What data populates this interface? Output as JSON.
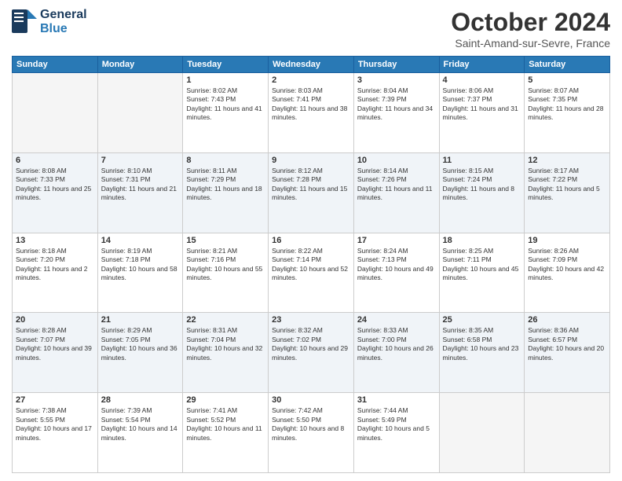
{
  "header": {
    "logo_line1": "General",
    "logo_line2": "Blue",
    "month": "October 2024",
    "location": "Saint-Amand-sur-Sevre, France"
  },
  "days_of_week": [
    "Sunday",
    "Monday",
    "Tuesday",
    "Wednesday",
    "Thursday",
    "Friday",
    "Saturday"
  ],
  "weeks": [
    [
      {
        "day": "",
        "text": ""
      },
      {
        "day": "",
        "text": ""
      },
      {
        "day": "1",
        "text": "Sunrise: 8:02 AM\nSunset: 7:43 PM\nDaylight: 11 hours and 41 minutes."
      },
      {
        "day": "2",
        "text": "Sunrise: 8:03 AM\nSunset: 7:41 PM\nDaylight: 11 hours and 38 minutes."
      },
      {
        "day": "3",
        "text": "Sunrise: 8:04 AM\nSunset: 7:39 PM\nDaylight: 11 hours and 34 minutes."
      },
      {
        "day": "4",
        "text": "Sunrise: 8:06 AM\nSunset: 7:37 PM\nDaylight: 11 hours and 31 minutes."
      },
      {
        "day": "5",
        "text": "Sunrise: 8:07 AM\nSunset: 7:35 PM\nDaylight: 11 hours and 28 minutes."
      }
    ],
    [
      {
        "day": "6",
        "text": "Sunrise: 8:08 AM\nSunset: 7:33 PM\nDaylight: 11 hours and 25 minutes."
      },
      {
        "day": "7",
        "text": "Sunrise: 8:10 AM\nSunset: 7:31 PM\nDaylight: 11 hours and 21 minutes."
      },
      {
        "day": "8",
        "text": "Sunrise: 8:11 AM\nSunset: 7:29 PM\nDaylight: 11 hours and 18 minutes."
      },
      {
        "day": "9",
        "text": "Sunrise: 8:12 AM\nSunset: 7:28 PM\nDaylight: 11 hours and 15 minutes."
      },
      {
        "day": "10",
        "text": "Sunrise: 8:14 AM\nSunset: 7:26 PM\nDaylight: 11 hours and 11 minutes."
      },
      {
        "day": "11",
        "text": "Sunrise: 8:15 AM\nSunset: 7:24 PM\nDaylight: 11 hours and 8 minutes."
      },
      {
        "day": "12",
        "text": "Sunrise: 8:17 AM\nSunset: 7:22 PM\nDaylight: 11 hours and 5 minutes."
      }
    ],
    [
      {
        "day": "13",
        "text": "Sunrise: 8:18 AM\nSunset: 7:20 PM\nDaylight: 11 hours and 2 minutes."
      },
      {
        "day": "14",
        "text": "Sunrise: 8:19 AM\nSunset: 7:18 PM\nDaylight: 10 hours and 58 minutes."
      },
      {
        "day": "15",
        "text": "Sunrise: 8:21 AM\nSunset: 7:16 PM\nDaylight: 10 hours and 55 minutes."
      },
      {
        "day": "16",
        "text": "Sunrise: 8:22 AM\nSunset: 7:14 PM\nDaylight: 10 hours and 52 minutes."
      },
      {
        "day": "17",
        "text": "Sunrise: 8:24 AM\nSunset: 7:13 PM\nDaylight: 10 hours and 49 minutes."
      },
      {
        "day": "18",
        "text": "Sunrise: 8:25 AM\nSunset: 7:11 PM\nDaylight: 10 hours and 45 minutes."
      },
      {
        "day": "19",
        "text": "Sunrise: 8:26 AM\nSunset: 7:09 PM\nDaylight: 10 hours and 42 minutes."
      }
    ],
    [
      {
        "day": "20",
        "text": "Sunrise: 8:28 AM\nSunset: 7:07 PM\nDaylight: 10 hours and 39 minutes."
      },
      {
        "day": "21",
        "text": "Sunrise: 8:29 AM\nSunset: 7:05 PM\nDaylight: 10 hours and 36 minutes."
      },
      {
        "day": "22",
        "text": "Sunrise: 8:31 AM\nSunset: 7:04 PM\nDaylight: 10 hours and 32 minutes."
      },
      {
        "day": "23",
        "text": "Sunrise: 8:32 AM\nSunset: 7:02 PM\nDaylight: 10 hours and 29 minutes."
      },
      {
        "day": "24",
        "text": "Sunrise: 8:33 AM\nSunset: 7:00 PM\nDaylight: 10 hours and 26 minutes."
      },
      {
        "day": "25",
        "text": "Sunrise: 8:35 AM\nSunset: 6:58 PM\nDaylight: 10 hours and 23 minutes."
      },
      {
        "day": "26",
        "text": "Sunrise: 8:36 AM\nSunset: 6:57 PM\nDaylight: 10 hours and 20 minutes."
      }
    ],
    [
      {
        "day": "27",
        "text": "Sunrise: 7:38 AM\nSunset: 5:55 PM\nDaylight: 10 hours and 17 minutes."
      },
      {
        "day": "28",
        "text": "Sunrise: 7:39 AM\nSunset: 5:54 PM\nDaylight: 10 hours and 14 minutes."
      },
      {
        "day": "29",
        "text": "Sunrise: 7:41 AM\nSunset: 5:52 PM\nDaylight: 10 hours and 11 minutes."
      },
      {
        "day": "30",
        "text": "Sunrise: 7:42 AM\nSunset: 5:50 PM\nDaylight: 10 hours and 8 minutes."
      },
      {
        "day": "31",
        "text": "Sunrise: 7:44 AM\nSunset: 5:49 PM\nDaylight: 10 hours and 5 minutes."
      },
      {
        "day": "",
        "text": ""
      },
      {
        "day": "",
        "text": ""
      }
    ]
  ]
}
